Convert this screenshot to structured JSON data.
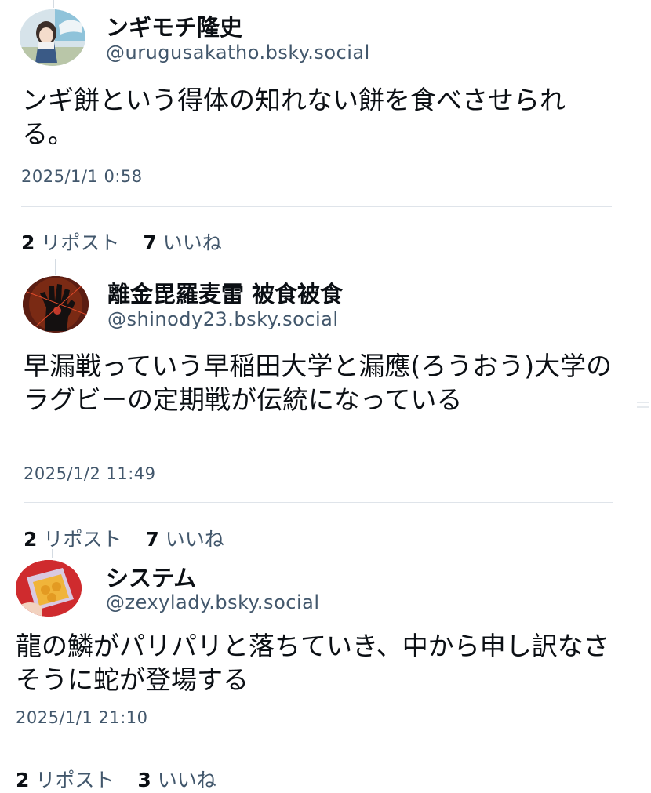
{
  "posts": [
    {
      "name": "ンギモチ隆史",
      "handle": "@urugusakatho.bsky.social",
      "text": "ンギ餅という得体の知れない餅を食べさせられる。",
      "time": "2025/1/1 0:58",
      "reposts": "2",
      "repost_label": "リポスト",
      "likes": "7",
      "like_label": "いいね",
      "avatar_icon": "anime-girl-avatar"
    },
    {
      "name": "離金毘羅麦雷 被食被食",
      "handle": "@shinody23.bsky.social",
      "text": "早漏戦っていう早稲田大学と漏應(ろうおう)大学のラグビーの定期戦が伝統になっている",
      "time": "2025/1/2 11:49",
      "reposts": "2",
      "repost_label": "リポスト",
      "likes": "7",
      "like_label": "いいね",
      "avatar_icon": "dark-hand-avatar"
    },
    {
      "name": "システム",
      "handle": "@zexylady.bsky.social",
      "text": "龍の鱗がパリパリと落ちていき、中から申し訳なさそうに蛇が登場する",
      "time": "2025/1/1 21:10",
      "reposts": "2",
      "repost_label": "リポスト",
      "likes": "3",
      "like_label": "いいね",
      "avatar_icon": "food-package-avatar"
    }
  ]
}
